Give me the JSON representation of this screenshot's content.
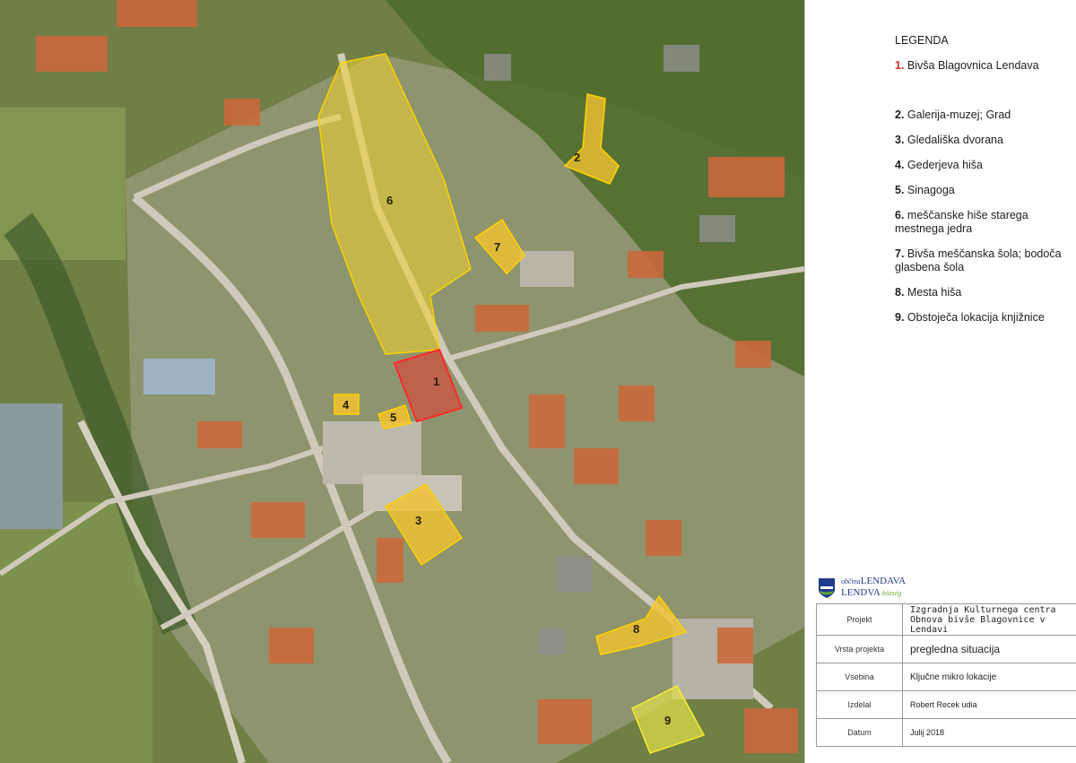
{
  "legend": {
    "title": "LEGENDA",
    "items": [
      {
        "num": "1.",
        "label": "Bivša Blagovnica Lendava"
      },
      {
        "num": "2.",
        "label": "Galerija-muzej; Grad"
      },
      {
        "num": "3.",
        "label": "Gledališka dvorana"
      },
      {
        "num": "4.",
        "label": "Gederjeva hiša"
      },
      {
        "num": "5.",
        "label": "Sinagoga"
      },
      {
        "num": "6.",
        "label": "meščanske hiše starega mestnega jedra"
      },
      {
        "num": "7.",
        "label": "Bivša meščanska šola; bodoča glasbena šola"
      },
      {
        "num": "8.",
        "label": "Mesta hiša"
      },
      {
        "num": "9.",
        "label": "Obstoječa lokacija knjižnice"
      }
    ]
  },
  "map_labels": {
    "z1": "1",
    "z2": "2",
    "z3": "3",
    "z4": "4",
    "z5": "5",
    "z6": "6",
    "z7": "7",
    "z8": "8",
    "z9": "9"
  },
  "colors": {
    "highlight_red": "#e53935",
    "highlight_yellow": "#f2c230",
    "highlight_green": "#e3e14a",
    "logo_blue": "#1f3c8c",
    "logo_green": "#6aa832"
  },
  "logo": {
    "small_top": "občina",
    "name_top": "LENDAVA",
    "name_bottom": "LENDVA",
    "small_bottom": "község"
  },
  "title_block": {
    "projekt_label": "Projekt",
    "projekt_line1": "Izgradnja Kulturnega centra",
    "projekt_line2": "Obnova bivše Blagovnice v Lendavi",
    "vrsta_label": "Vrsta projekta",
    "vrsta_value": "pregledna situacija",
    "vsebina_label": "Vsebina",
    "vsebina_value": "Ključne mikro lokacije",
    "izdelal_label": "Izdelal",
    "izdelal_value": "Robert Recek udia",
    "datum_label": "Datum",
    "datum_value": "Julij 2018"
  }
}
